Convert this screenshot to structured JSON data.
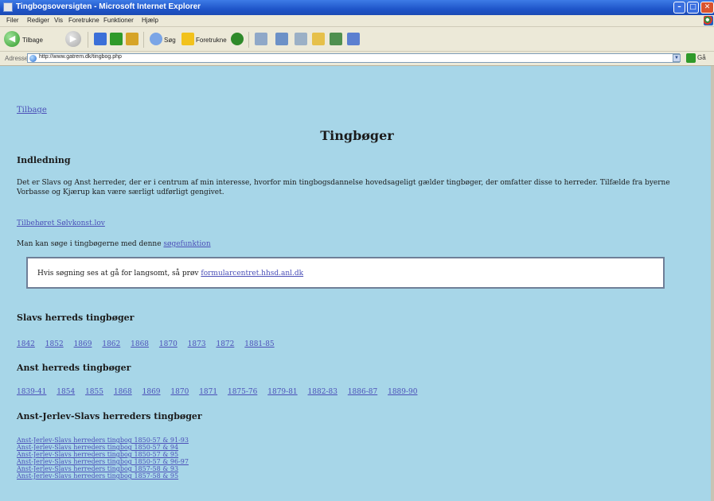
{
  "window": {
    "title": "Tingbogsoversigten - Microsoft Internet Explorer",
    "min_glyph": "–",
    "max_glyph": "□",
    "close_glyph": "✕"
  },
  "menubar": {
    "items": [
      "Filer",
      "Rediger",
      "Vis",
      "Foretrukne",
      "Funktioner",
      "Hjælp"
    ]
  },
  "toolbar": {
    "back_label": "Tilbage",
    "search_label": "Søg",
    "favorites_label": "Foretrukne"
  },
  "address": {
    "label": "Adresse",
    "url": "http://www.gatrem.dk/tingbog.php",
    "go_label": "Gå"
  },
  "content": {
    "back_link": "Tilbage",
    "title": "Tingbøger",
    "intro_heading": "Indledning",
    "intro_text": "Det er Slavs og Anst herreder, der er i centrum af min interesse, hvorfor min tingbogsdannelse hovedsageligt gælder tingbøger, der omfatter disse to herreder. Tilfælde fra byerne Vorbasse og Kjærup kan være særligt udførligt gengivet.",
    "folder_link": "Tilbehøret Sølvkonst.lov",
    "search_text": "Man kan søge i tingbøgerne med denne",
    "search_link": "søgefunktion",
    "box_text": "Hvis søgning ses at gå for langsomt, så prøv",
    "box_link": "formularcentret.hhsd.anl.dk",
    "slavs_heading": "Slavs herreds tingbøger",
    "slavs_years": [
      "1842",
      "1852",
      "1869",
      "1862",
      "1868",
      "1870",
      "1873",
      "1872",
      "1881-85"
    ],
    "anst_heading": "Anst herreds tingbøger",
    "anst_years": [
      "1839-41",
      "1854",
      "1855",
      "1868",
      "1869",
      "1870",
      "1871",
      "1875-76",
      "1879-81",
      "1882-83",
      "1886-87",
      "1889-90"
    ],
    "combined_heading": "Anst-Jerlev-Slavs herreders tingbøger",
    "combined_links": [
      "Anst-Jerlev-Slavs herreders tingbog 1850-57 & 91-93",
      "Anst-Jerlev-Slavs herreders tingbog 1850-57 & 94",
      "Anst-Jerlev-Slavs herreders tingbog 1850-57 & 95",
      "Anst-Jerlev-Slavs herreders tingbog 1850-57 & 96-97",
      "Anst-Jerlev-Slavs herreders tingbog 1857-58 & 93",
      "Anst-Jerlev-Slavs herreders tingbog 1857-58 & 95"
    ]
  },
  "colors": {
    "page_background": "#a7d6e8",
    "link": "#4b4fb8",
    "titlebar": "#1f55c9"
  }
}
